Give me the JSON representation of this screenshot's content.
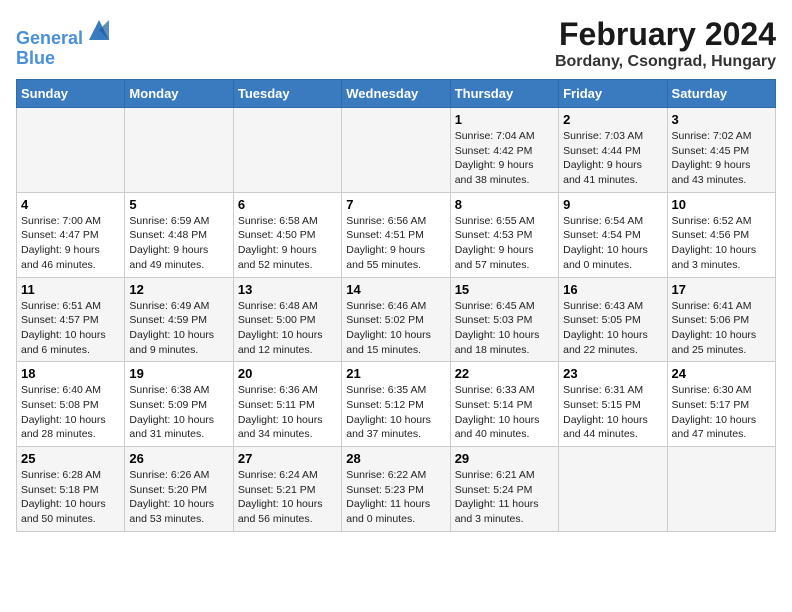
{
  "header": {
    "logo_line1": "General",
    "logo_line2": "Blue",
    "month": "February 2024",
    "location": "Bordany, Csongrad, Hungary"
  },
  "weekdays": [
    "Sunday",
    "Monday",
    "Tuesday",
    "Wednesday",
    "Thursday",
    "Friday",
    "Saturday"
  ],
  "weeks": [
    [
      {
        "day": "",
        "info": ""
      },
      {
        "day": "",
        "info": ""
      },
      {
        "day": "",
        "info": ""
      },
      {
        "day": "",
        "info": ""
      },
      {
        "day": "1",
        "info": "Sunrise: 7:04 AM\nSunset: 4:42 PM\nDaylight: 9 hours\nand 38 minutes."
      },
      {
        "day": "2",
        "info": "Sunrise: 7:03 AM\nSunset: 4:44 PM\nDaylight: 9 hours\nand 41 minutes."
      },
      {
        "day": "3",
        "info": "Sunrise: 7:02 AM\nSunset: 4:45 PM\nDaylight: 9 hours\nand 43 minutes."
      }
    ],
    [
      {
        "day": "4",
        "info": "Sunrise: 7:00 AM\nSunset: 4:47 PM\nDaylight: 9 hours\nand 46 minutes."
      },
      {
        "day": "5",
        "info": "Sunrise: 6:59 AM\nSunset: 4:48 PM\nDaylight: 9 hours\nand 49 minutes."
      },
      {
        "day": "6",
        "info": "Sunrise: 6:58 AM\nSunset: 4:50 PM\nDaylight: 9 hours\nand 52 minutes."
      },
      {
        "day": "7",
        "info": "Sunrise: 6:56 AM\nSunset: 4:51 PM\nDaylight: 9 hours\nand 55 minutes."
      },
      {
        "day": "8",
        "info": "Sunrise: 6:55 AM\nSunset: 4:53 PM\nDaylight: 9 hours\nand 57 minutes."
      },
      {
        "day": "9",
        "info": "Sunrise: 6:54 AM\nSunset: 4:54 PM\nDaylight: 10 hours\nand 0 minutes."
      },
      {
        "day": "10",
        "info": "Sunrise: 6:52 AM\nSunset: 4:56 PM\nDaylight: 10 hours\nand 3 minutes."
      }
    ],
    [
      {
        "day": "11",
        "info": "Sunrise: 6:51 AM\nSunset: 4:57 PM\nDaylight: 10 hours\nand 6 minutes."
      },
      {
        "day": "12",
        "info": "Sunrise: 6:49 AM\nSunset: 4:59 PM\nDaylight: 10 hours\nand 9 minutes."
      },
      {
        "day": "13",
        "info": "Sunrise: 6:48 AM\nSunset: 5:00 PM\nDaylight: 10 hours\nand 12 minutes."
      },
      {
        "day": "14",
        "info": "Sunrise: 6:46 AM\nSunset: 5:02 PM\nDaylight: 10 hours\nand 15 minutes."
      },
      {
        "day": "15",
        "info": "Sunrise: 6:45 AM\nSunset: 5:03 PM\nDaylight: 10 hours\nand 18 minutes."
      },
      {
        "day": "16",
        "info": "Sunrise: 6:43 AM\nSunset: 5:05 PM\nDaylight: 10 hours\nand 22 minutes."
      },
      {
        "day": "17",
        "info": "Sunrise: 6:41 AM\nSunset: 5:06 PM\nDaylight: 10 hours\nand 25 minutes."
      }
    ],
    [
      {
        "day": "18",
        "info": "Sunrise: 6:40 AM\nSunset: 5:08 PM\nDaylight: 10 hours\nand 28 minutes."
      },
      {
        "day": "19",
        "info": "Sunrise: 6:38 AM\nSunset: 5:09 PM\nDaylight: 10 hours\nand 31 minutes."
      },
      {
        "day": "20",
        "info": "Sunrise: 6:36 AM\nSunset: 5:11 PM\nDaylight: 10 hours\nand 34 minutes."
      },
      {
        "day": "21",
        "info": "Sunrise: 6:35 AM\nSunset: 5:12 PM\nDaylight: 10 hours\nand 37 minutes."
      },
      {
        "day": "22",
        "info": "Sunrise: 6:33 AM\nSunset: 5:14 PM\nDaylight: 10 hours\nand 40 minutes."
      },
      {
        "day": "23",
        "info": "Sunrise: 6:31 AM\nSunset: 5:15 PM\nDaylight: 10 hours\nand 44 minutes."
      },
      {
        "day": "24",
        "info": "Sunrise: 6:30 AM\nSunset: 5:17 PM\nDaylight: 10 hours\nand 47 minutes."
      }
    ],
    [
      {
        "day": "25",
        "info": "Sunrise: 6:28 AM\nSunset: 5:18 PM\nDaylight: 10 hours\nand 50 minutes."
      },
      {
        "day": "26",
        "info": "Sunrise: 6:26 AM\nSunset: 5:20 PM\nDaylight: 10 hours\nand 53 minutes."
      },
      {
        "day": "27",
        "info": "Sunrise: 6:24 AM\nSunset: 5:21 PM\nDaylight: 10 hours\nand 56 minutes."
      },
      {
        "day": "28",
        "info": "Sunrise: 6:22 AM\nSunset: 5:23 PM\nDaylight: 11 hours\nand 0 minutes."
      },
      {
        "day": "29",
        "info": "Sunrise: 6:21 AM\nSunset: 5:24 PM\nDaylight: 11 hours\nand 3 minutes."
      },
      {
        "day": "",
        "info": ""
      },
      {
        "day": "",
        "info": ""
      }
    ]
  ]
}
